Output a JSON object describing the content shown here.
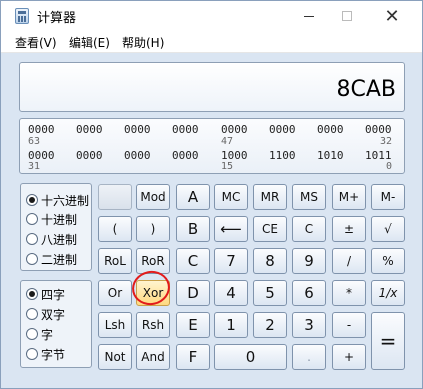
{
  "window": {
    "title": "计算器",
    "close_glyph": "✕"
  },
  "menu": {
    "items": [
      "查看(V)",
      "编辑(E)",
      "帮助(H)"
    ]
  },
  "display": {
    "value": "8CAB"
  },
  "bits": {
    "row1": [
      "0000",
      "0000",
      "0000",
      "0000",
      "0000",
      "0000",
      "0000",
      "0000"
    ],
    "row1_positions": [
      "63",
      "47",
      "32"
    ],
    "row2": [
      "0000",
      "0000",
      "0000",
      "0000",
      "1000",
      "1100",
      "1010",
      "1011"
    ],
    "row2_positions": [
      "31",
      "15",
      "0"
    ]
  },
  "base_options": [
    {
      "label": "十六进制",
      "checked": true
    },
    {
      "label": "十进制",
      "checked": false
    },
    {
      "label": "八进制",
      "checked": false
    },
    {
      "label": "二进制",
      "checked": false
    }
  ],
  "word_options": [
    {
      "label": "四字",
      "checked": true
    },
    {
      "label": "双字",
      "checked": false
    },
    {
      "label": "字",
      "checked": false
    },
    {
      "label": "字节",
      "checked": false
    }
  ],
  "keys": {
    "mod": "Mod",
    "A": "A",
    "MC": "MC",
    "MR": "MR",
    "MS": "MS",
    "Mplus": "M+",
    "Mminus": "M-",
    "lparen": "(",
    "rparen": ")",
    "B": "B",
    "back": "⟵",
    "CE": "CE",
    "C": "C",
    "plusminus": "±",
    "sqrt": "√",
    "RoL": "RoL",
    "RoR": "RoR",
    "Ckey": "C",
    "seven": "7",
    "eight": "8",
    "nine": "9",
    "div": "/",
    "pct": "%",
    "Or": "Or",
    "Xor": "Xor",
    "D": "D",
    "four": "4",
    "five": "5",
    "six": "6",
    "mul": "*",
    "recip": "1/x",
    "Lsh": "Lsh",
    "Rsh": "Rsh",
    "E": "E",
    "one": "1",
    "two": "2",
    "three": "3",
    "minus": "-",
    "equals": "=",
    "Not": "Not",
    "And": "And",
    "F": "F",
    "zero": "0",
    "dot": ".",
    "plus": "+"
  }
}
